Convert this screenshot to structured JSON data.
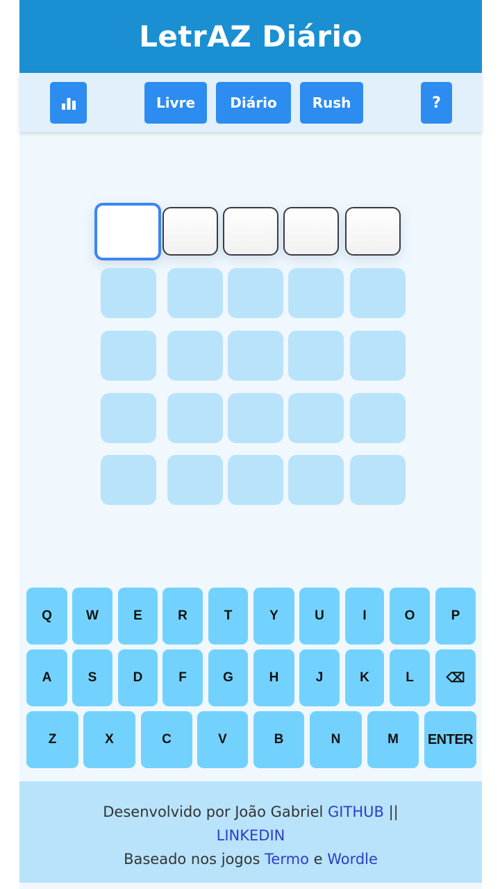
{
  "header": {
    "title": "LetrAZ Diário"
  },
  "toolbar": {
    "stats_icon": "bar-chart-icon",
    "modes": [
      "Livre",
      "Diário",
      "Rush"
    ],
    "help_label": "?"
  },
  "board": {
    "rows": 5,
    "columns": 5,
    "active_row": 0,
    "selected_column": 0
  },
  "keyboard": {
    "row1": [
      "Q",
      "W",
      "E",
      "R",
      "T",
      "Y",
      "U",
      "I",
      "O",
      "P"
    ],
    "row2": [
      "A",
      "S",
      "D",
      "F",
      "G",
      "H",
      "J",
      "K",
      "L",
      "⌫"
    ],
    "row3": [
      "Z",
      "X",
      "C",
      "V",
      "B",
      "N",
      "M",
      "ENTER"
    ],
    "backspace_icon": "backspace-icon"
  },
  "footer": {
    "line1_prefix": "Desenvolvido por João Gabriel ",
    "github_link": "GITHUB",
    "separator": " ||",
    "linkedin_link": "LINKEDIN",
    "line3_prefix": "Baseado nos jogos ",
    "termo_link": "Termo",
    "conjunction": " e ",
    "wordle_link": "Wordle"
  },
  "colors": {
    "header_bg": "#1a8fd2",
    "button_bg": "#2d8cf0",
    "key_bg": "#73d2fd",
    "empty_tile": "#b8e3fb",
    "selected_border": "#3a86f5",
    "link": "#2d3ec4"
  }
}
